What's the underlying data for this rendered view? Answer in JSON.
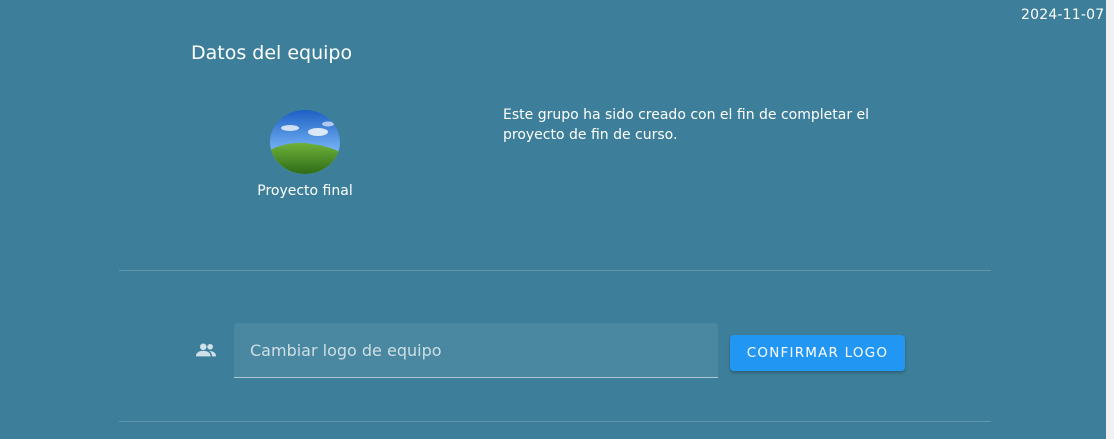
{
  "header": {
    "date": "2024-11-07"
  },
  "team": {
    "section_title": "Datos del equipo",
    "name": "Proyecto final",
    "description": "Este grupo ha sido creado con el fin de completar el proyecto de fin de curso.",
    "logo_icon": "landscape-logo-image"
  },
  "logo_form": {
    "icon": "group-icon",
    "placeholder": "Cambiar logo de equipo",
    "value": "",
    "confirm_label": "CONFIRMAR LOGO"
  },
  "colors": {
    "background": "#3d7f9a",
    "button": "#2196f3",
    "text": "#ffffff"
  }
}
